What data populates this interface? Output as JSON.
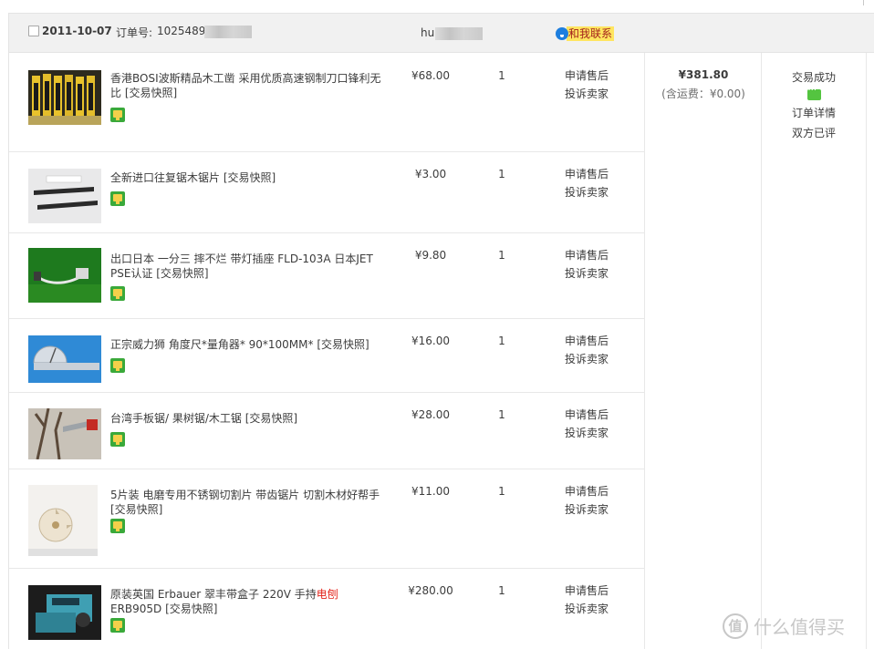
{
  "order": {
    "date": "2011-10-07",
    "order_label": "订单号:",
    "order_number": "10254894",
    "seller_prefix": "hu",
    "contact_label": "和我联系",
    "total_amount": "¥381.80",
    "shipping_note": "(含运费：¥0.00)",
    "status": "交易成功",
    "detail_link": "订单详情",
    "review_status": "双方已评"
  },
  "items": [
    {
      "title": "香港BOSI波斯精品木工凿 采用优质高速钢制刀口锋利无比 [交易快照]",
      "price": "¥68.00",
      "qty": "1",
      "after_sale": "申请售后",
      "complain": "投诉卖家"
    },
    {
      "title": "全新进口往复锯木锯片 [交易快照]",
      "price": "¥3.00",
      "qty": "1",
      "after_sale": "申请售后",
      "complain": "投诉卖家"
    },
    {
      "title": "出口日本 一分三 摔不烂 带灯插座 FLD-103A 日本JET PSE认证 [交易快照]",
      "price": "¥9.80",
      "qty": "1",
      "after_sale": "申请售后",
      "complain": "投诉卖家"
    },
    {
      "title": "正宗威力狮 角度尺*量角器* 90*100MM* [交易快照]",
      "price": "¥16.00",
      "qty": "1",
      "after_sale": "申请售后",
      "complain": "投诉卖家"
    },
    {
      "title": "台湾手板锯/ 果树锯/木工锯 [交易快照]",
      "price": "¥28.00",
      "qty": "1",
      "after_sale": "申请售后",
      "complain": "投诉卖家"
    },
    {
      "title": "5片装 电磨专用不锈钢切割片 带齿锯片 切割木材好帮手 [交易快照]",
      "price": "¥11.00",
      "qty": "1",
      "after_sale": "申请售后",
      "complain": "投诉卖家"
    },
    {
      "title_a": "原装英国 Erbauer 翠丰带盒子 220V 手持",
      "title_red": "电刨",
      "title_b": " ERB905D [交易快照]",
      "price": "¥280.00",
      "qty": "1",
      "after_sale": "申请售后",
      "complain": "投诉卖家"
    }
  ],
  "watermark": {
    "icon_char": "值",
    "text": "什么值得买"
  }
}
